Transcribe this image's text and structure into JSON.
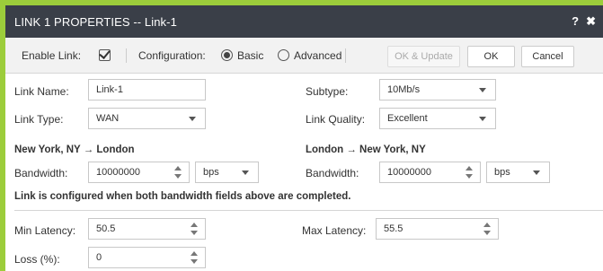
{
  "title": "LINK 1 PROPERTIES -- Link-1",
  "toolbar": {
    "enable_link_label": "Enable Link:",
    "configuration_label": "Configuration:",
    "basic_label": "Basic",
    "advanced_label": "Advanced",
    "ok_update_label": "OK & Update",
    "ok_label": "OK",
    "cancel_label": "Cancel",
    "enable_link_checked": true,
    "configuration_selected": "Basic"
  },
  "form": {
    "link_name_label": "Link Name:",
    "link_name_value": "Link-1",
    "subtype_label": "Subtype:",
    "subtype_value": "10Mb/s",
    "link_type_label": "Link Type:",
    "link_type_value": "WAN",
    "link_quality_label": "Link Quality:",
    "link_quality_value": "Excellent",
    "left_heading": "New York, NY → London",
    "right_heading": "London → New York, NY",
    "bandwidth_label": "Bandwidth:",
    "left_bandwidth_value": "10000000",
    "left_bandwidth_unit": "bps",
    "right_bandwidth_value": "10000000",
    "right_bandwidth_unit": "bps",
    "note": "Link is configured when both bandwidth fields above are completed.",
    "min_latency_label": "Min Latency:",
    "min_latency_value": "50.5",
    "max_latency_label": "Max Latency:",
    "max_latency_value": "55.5",
    "loss_label": "Loss (%):",
    "loss_value": "0"
  },
  "colors": {
    "frame": "#9ccd3b",
    "titlebar": "#3a3f48"
  }
}
